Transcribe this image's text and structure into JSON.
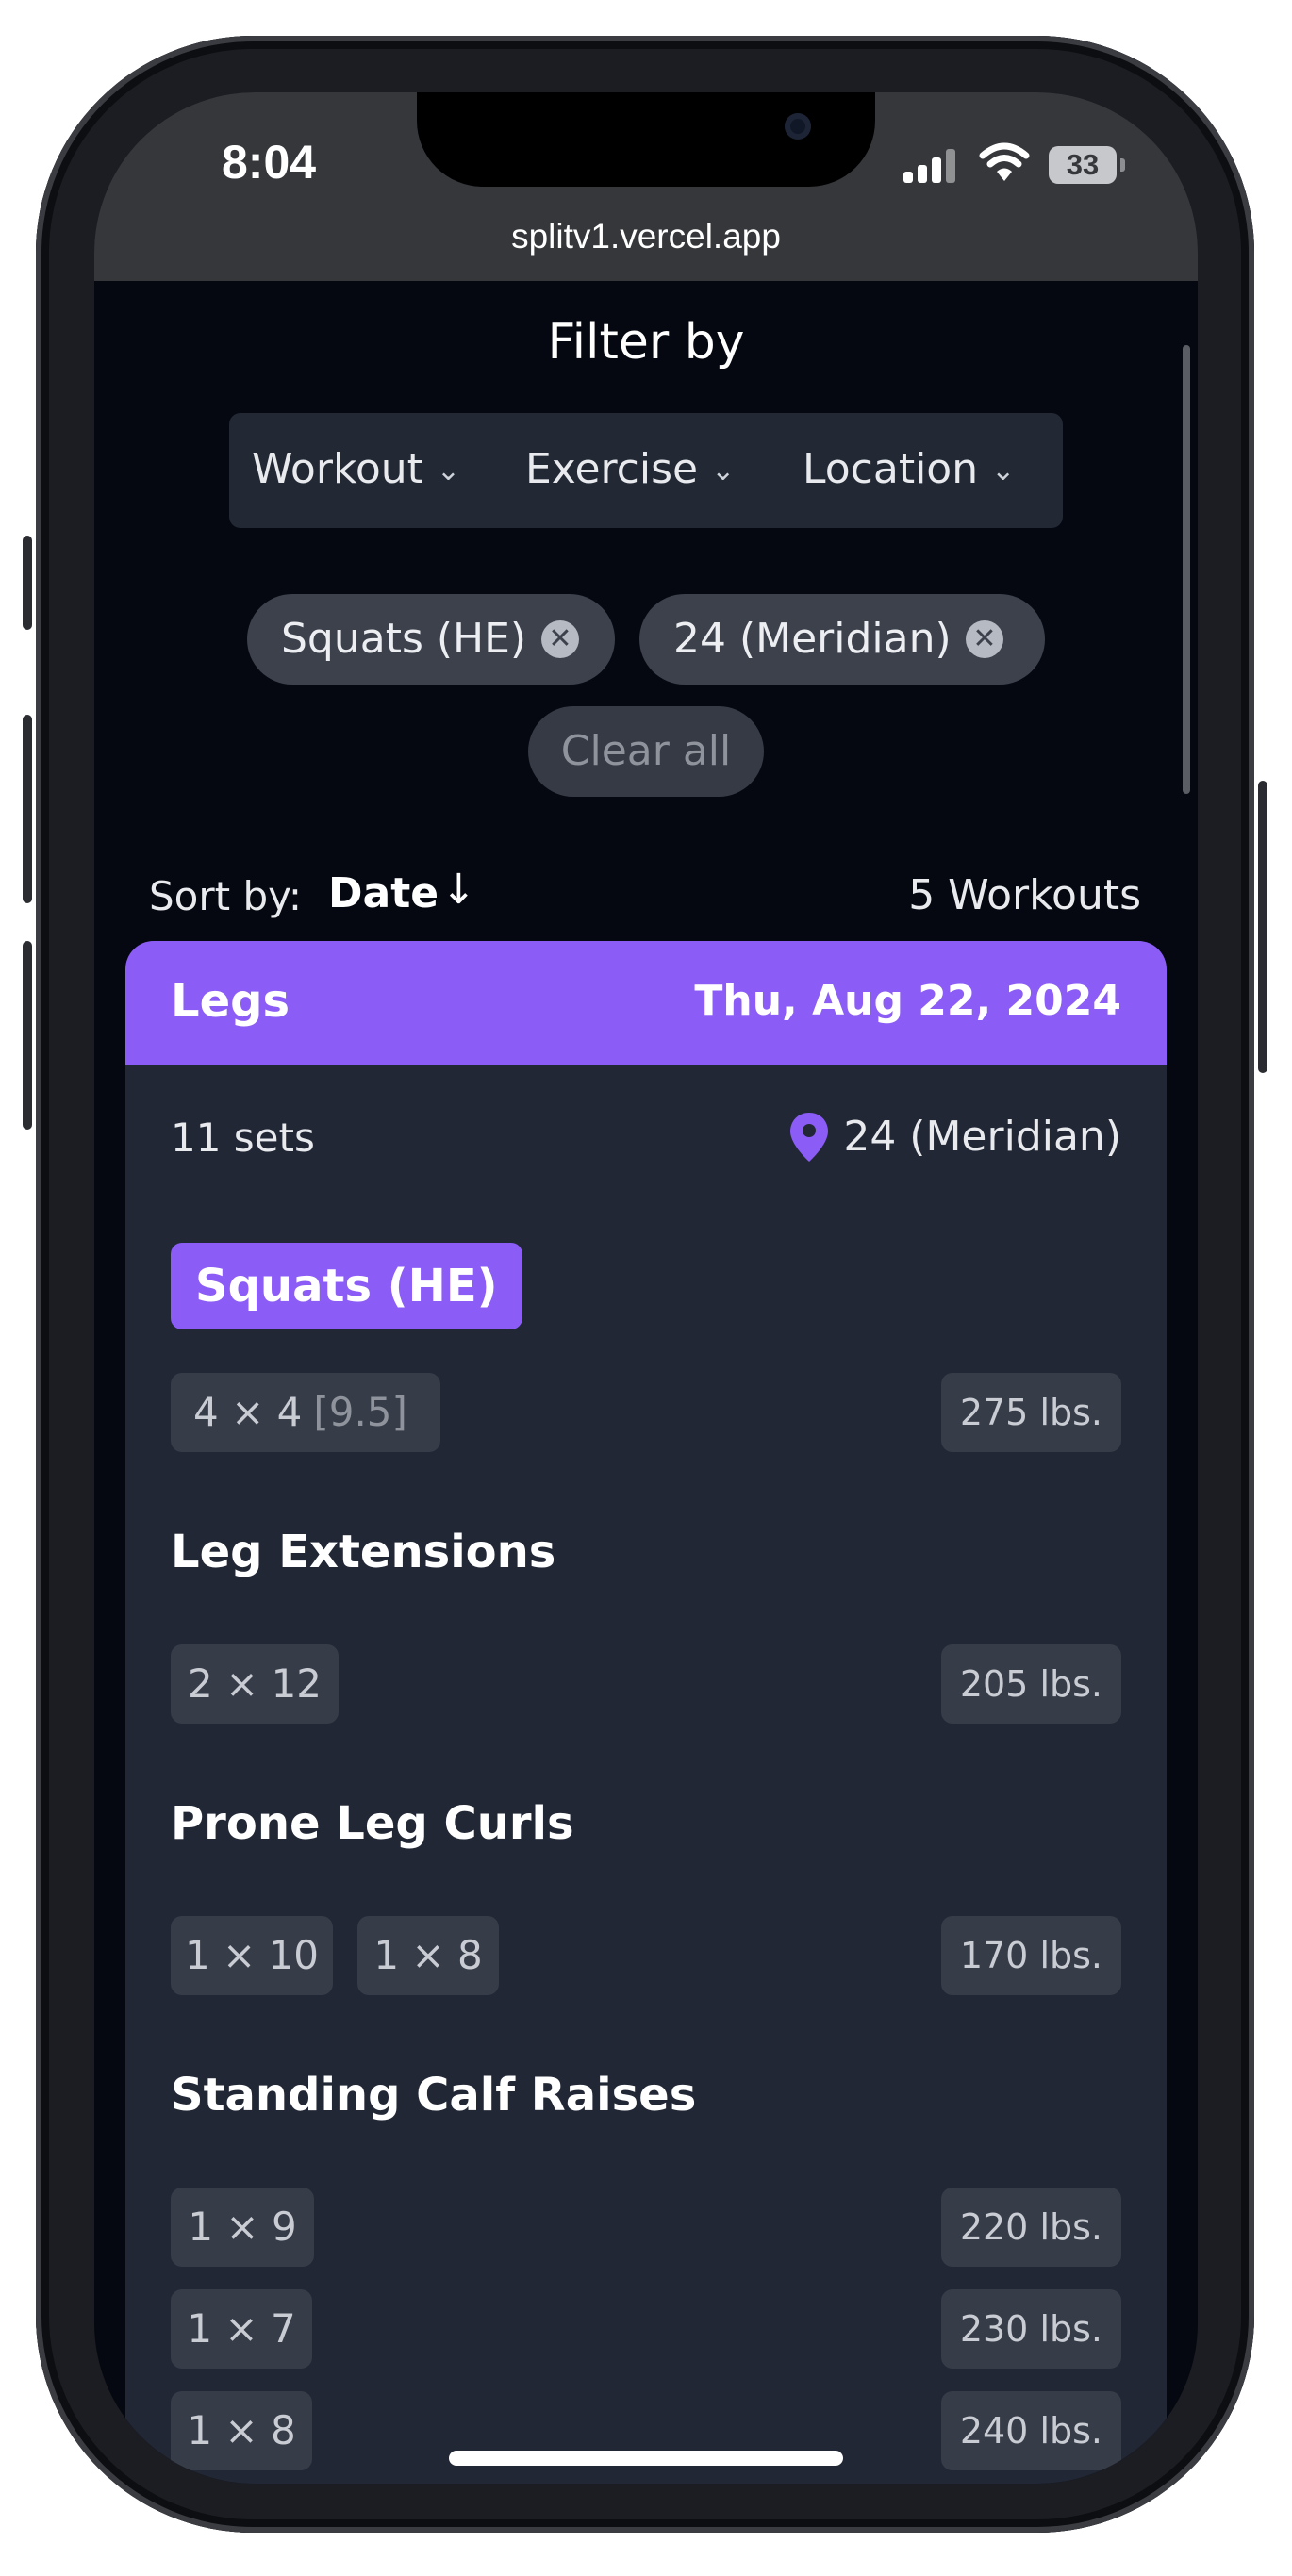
{
  "status_bar": {
    "time": "8:04",
    "battery": "33",
    "url": "splitv1.vercel.app"
  },
  "filter": {
    "title": "Filter by",
    "dropdowns": [
      "Workout",
      "Exercise",
      "Location"
    ],
    "chips": [
      "Squats (HE)",
      "24 (Meridian)"
    ],
    "clear_label": "Clear all"
  },
  "sort": {
    "label": "Sort by:",
    "value": "Date",
    "count": "5 Workouts"
  },
  "workout": {
    "title": "Legs",
    "date": "Thu, Aug 22, 2024",
    "sets": "11 sets",
    "location": "24 (Meridian)",
    "exercises": [
      {
        "name": "Squats (HE)",
        "rows": [
          {
            "sets": [
              "4 × 4"
            ],
            "rpe": "[9.5]",
            "weight": "275 lbs."
          }
        ]
      },
      {
        "name": "Leg Extensions",
        "rows": [
          {
            "sets": [
              "2 × 12"
            ],
            "weight": "205 lbs."
          }
        ]
      },
      {
        "name": "Prone Leg Curls",
        "rows": [
          {
            "sets": [
              "1 × 10",
              "1 × 8"
            ],
            "weight": "170 lbs."
          }
        ]
      },
      {
        "name": "Standing Calf Raises",
        "rows": [
          {
            "sets": [
              "1 × 9"
            ],
            "weight": "220 lbs."
          },
          {
            "sets": [
              "1 × 7"
            ],
            "weight": "230 lbs."
          },
          {
            "sets": [
              "1 × 8"
            ],
            "weight": "240 lbs."
          }
        ]
      }
    ]
  },
  "colors": {
    "accent": "#8b5cf6",
    "background": "#050810",
    "card": "#212735"
  }
}
